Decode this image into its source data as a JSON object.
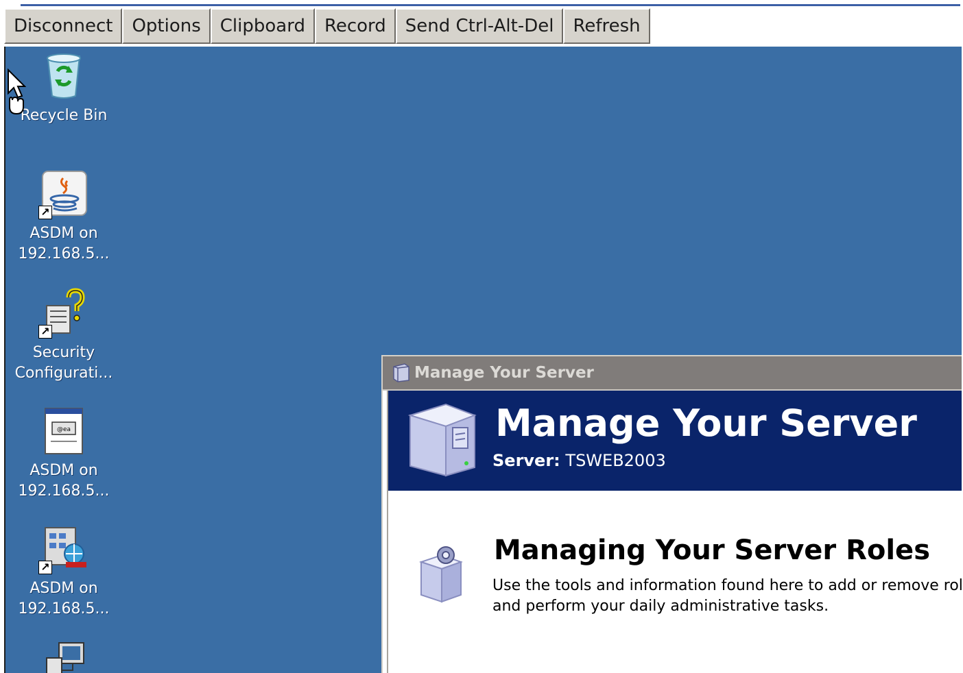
{
  "toolbar": {
    "buttons": [
      "Disconnect",
      "Options",
      "Clipboard",
      "Record",
      "Send Ctrl-Alt-Del",
      "Refresh"
    ]
  },
  "desktop": {
    "background_color": "#3a6ea5",
    "icons": [
      {
        "label": "Recycle Bin",
        "icon": "recycle-bin-icon"
      },
      {
        "label": "ASDM on 192.168.5...",
        "icon": "java-icon"
      },
      {
        "label": "Security Configurati...",
        "icon": "security-config-icon"
      },
      {
        "label": "ASDM on 192.168.5...",
        "icon": "document-icon"
      },
      {
        "label": "ASDM on 192.168.5...",
        "icon": "web-app-icon"
      },
      {
        "label": "",
        "icon": "computer-icon"
      }
    ]
  },
  "window": {
    "title": "Manage Your Server",
    "banner_title": "Manage Your Server",
    "server_label": "Server:",
    "server_name": "TSWEB2003",
    "section_title": "Managing Your Server Roles",
    "section_desc_line1": "Use the tools and information found here to add or remove roles",
    "section_desc_line2": "and perform your daily administrative tasks.",
    "banner_color": "#0a246a",
    "titlebar_color": "#807c7a"
  }
}
